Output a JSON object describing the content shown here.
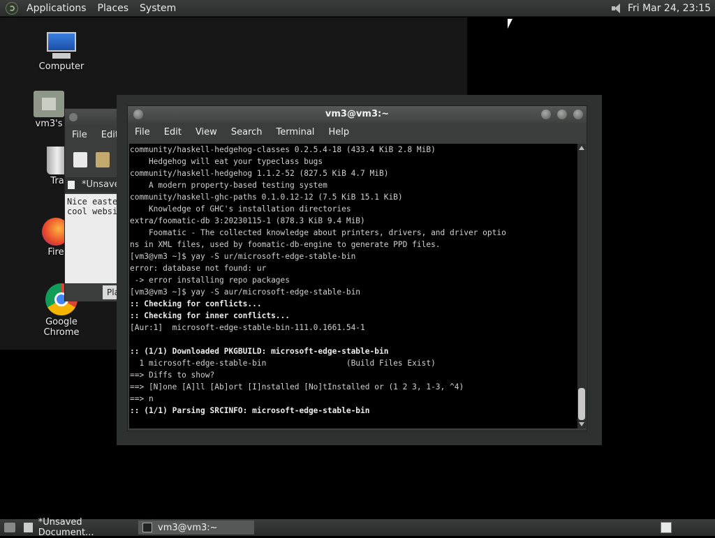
{
  "top_panel": {
    "menus": [
      "Applications",
      "Places",
      "System"
    ],
    "clock": "Fri Mar 24, 23:15"
  },
  "desktop": {
    "icons": [
      {
        "label": "Computer"
      },
      {
        "label": "vm3's"
      },
      {
        "label": "Tra"
      },
      {
        "label": "Fire"
      },
      {
        "label": "Google Chrome"
      }
    ]
  },
  "gedit": {
    "menus": [
      "File",
      "Edit"
    ],
    "tab_title": "*Unsaved",
    "text": "Nice easter\ncool websit",
    "status": "Plain T"
  },
  "terminal": {
    "title": "vm3@vm3:~",
    "menus": [
      "File",
      "Edit",
      "View",
      "Search",
      "Terminal",
      "Help"
    ],
    "lines": [
      {
        "text": "community/haskell-hedgehog-classes 0.2.5.4-18 (433.4 KiB 2.8 MiB)",
        "bold": false
      },
      {
        "text": "    Hedgehog will eat your typeclass bugs",
        "bold": false
      },
      {
        "text": "community/haskell-hedgehog 1.1.2-52 (827.5 KiB 4.7 MiB)",
        "bold": false
      },
      {
        "text": "    A modern property-based testing system",
        "bold": false
      },
      {
        "text": "community/haskell-ghc-paths 0.1.0.12-12 (7.5 KiB 15.1 KiB)",
        "bold": false
      },
      {
        "text": "    Knowledge of GHC's installation directories",
        "bold": false
      },
      {
        "text": "extra/foomatic-db 3:20230115-1 (878.3 KiB 9.4 MiB)",
        "bold": false
      },
      {
        "text": "    Foomatic - The collected knowledge about printers, drivers, and driver optio",
        "bold": false
      },
      {
        "text": "ns in XML files, used by foomatic-db-engine to generate PPD files.",
        "bold": false
      },
      {
        "text": "[vm3@vm3 ~]$ yay -S ur/microsoft-edge-stable-bin",
        "bold": false
      },
      {
        "text": "error: database not found: ur",
        "bold": false
      },
      {
        "text": " -> error installing repo packages",
        "bold": false
      },
      {
        "text": "[vm3@vm3 ~]$ yay -S aur/microsoft-edge-stable-bin",
        "bold": false
      },
      {
        "text": ":: Checking for conflicts...",
        "bold": true
      },
      {
        "text": ":: Checking for inner conflicts...",
        "bold": true
      },
      {
        "text": "[Aur:1]  microsoft-edge-stable-bin-111.0.1661.54-1",
        "bold": false
      },
      {
        "text": "",
        "bold": false
      },
      {
        "text": ":: (1/1) Downloaded PKGBUILD: microsoft-edge-stable-bin",
        "bold": true
      },
      {
        "text": "  1 microsoft-edge-stable-bin                 (Build Files Exist)",
        "bold": false
      },
      {
        "text": "==> Diffs to show?",
        "bold": false
      },
      {
        "text": "==> [N]one [A]ll [Ab]ort [I]nstalled [No]tInstalled or (1 2 3, 1-3, ^4)",
        "bold": false
      },
      {
        "text": "==> n",
        "bold": false
      },
      {
        "text": ":: (1/1) Parsing SRCINFO: microsoft-edge-stable-bin",
        "bold": true
      }
    ]
  },
  "taskbar": {
    "tasks": [
      {
        "label": "*Unsaved Document..."
      },
      {
        "label": "vm3@vm3:~"
      }
    ]
  }
}
